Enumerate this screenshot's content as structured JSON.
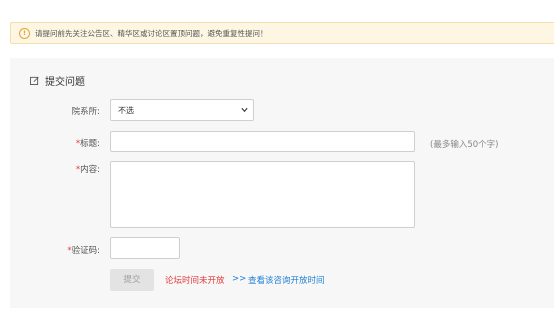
{
  "notice": {
    "icon": "info-icon",
    "text": "请提问前先关注公告区、精华区或讨论区置顶问题，避免重复性提问！"
  },
  "form": {
    "title": "提交问题",
    "title_icon": "edit-icon",
    "department_label": "院系所:",
    "department_selected": "不选",
    "title_field_label": "标题:",
    "title_field_value": "",
    "title_hint": "(最多输入50个字)",
    "content_label": "内容:",
    "content_value": "",
    "captcha_label": "验证码:",
    "captcha_value": "",
    "required_mark": "*",
    "submit_label": "提交",
    "closed_message": "论坛时间未开放",
    "link_arrows": ">>",
    "open_time_link": "查看该咨询开放时间"
  },
  "colors": {
    "notice_bg": "#fdf6e3",
    "warning": "#e6a23c",
    "required": "#e4393c",
    "link": "#1e7fd6"
  }
}
